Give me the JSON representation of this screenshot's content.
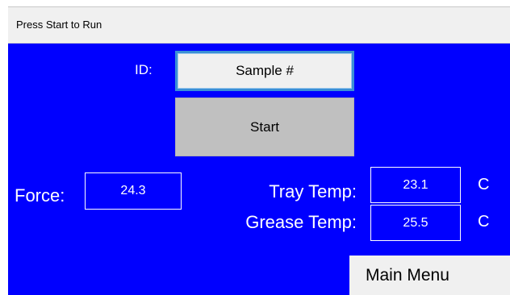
{
  "status_bar": {
    "message": "Press Start to Run"
  },
  "id_field": {
    "label": "ID:",
    "value": "Sample #"
  },
  "start_button": {
    "label": "Start"
  },
  "force": {
    "label": "Force:",
    "value": "24.3"
  },
  "tray_temp": {
    "label": "Tray Temp:",
    "value": "23.1",
    "unit": "C"
  },
  "grease_temp": {
    "label": "Grease Temp:",
    "value": "25.5",
    "unit": "C"
  },
  "main_menu": {
    "label": "Main Menu"
  },
  "colors": {
    "panel_bg": "#0000ff",
    "button_gray": "#c0c0c0",
    "field_border": "#3a8fd6",
    "text_on_panel": "#ffffff"
  }
}
